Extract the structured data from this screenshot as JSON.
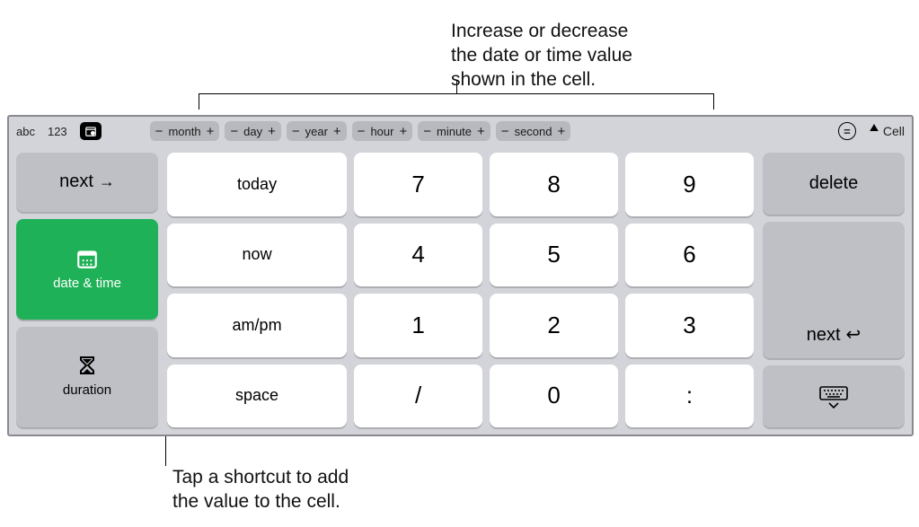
{
  "callouts": {
    "top_line1": "Increase or decrease",
    "top_line2": "the date or time value",
    "top_line3": "shown in the cell.",
    "bottom_line1": "Tap a shortcut to add",
    "bottom_line2": "the value to the cell."
  },
  "chromebar": {
    "mode_abc": "abc",
    "mode_123": "123",
    "steppers": [
      "month",
      "day",
      "year",
      "hour",
      "minute",
      "second"
    ],
    "minus": "−",
    "plus": "+",
    "cell_label": "Cell"
  },
  "left_keys": {
    "next": "next",
    "date_time": "date & time",
    "duration": "duration"
  },
  "shortcut_keys": {
    "today": "today",
    "now": "now",
    "ampm": "am/pm",
    "space": "space"
  },
  "numpad": {
    "r0": [
      "7",
      "8",
      "9"
    ],
    "r1": [
      "4",
      "5",
      "6"
    ],
    "r2": [
      "1",
      "2",
      "3"
    ],
    "r3": [
      "/",
      "0",
      ":"
    ]
  },
  "right_keys": {
    "delete": "delete",
    "next": "next"
  }
}
